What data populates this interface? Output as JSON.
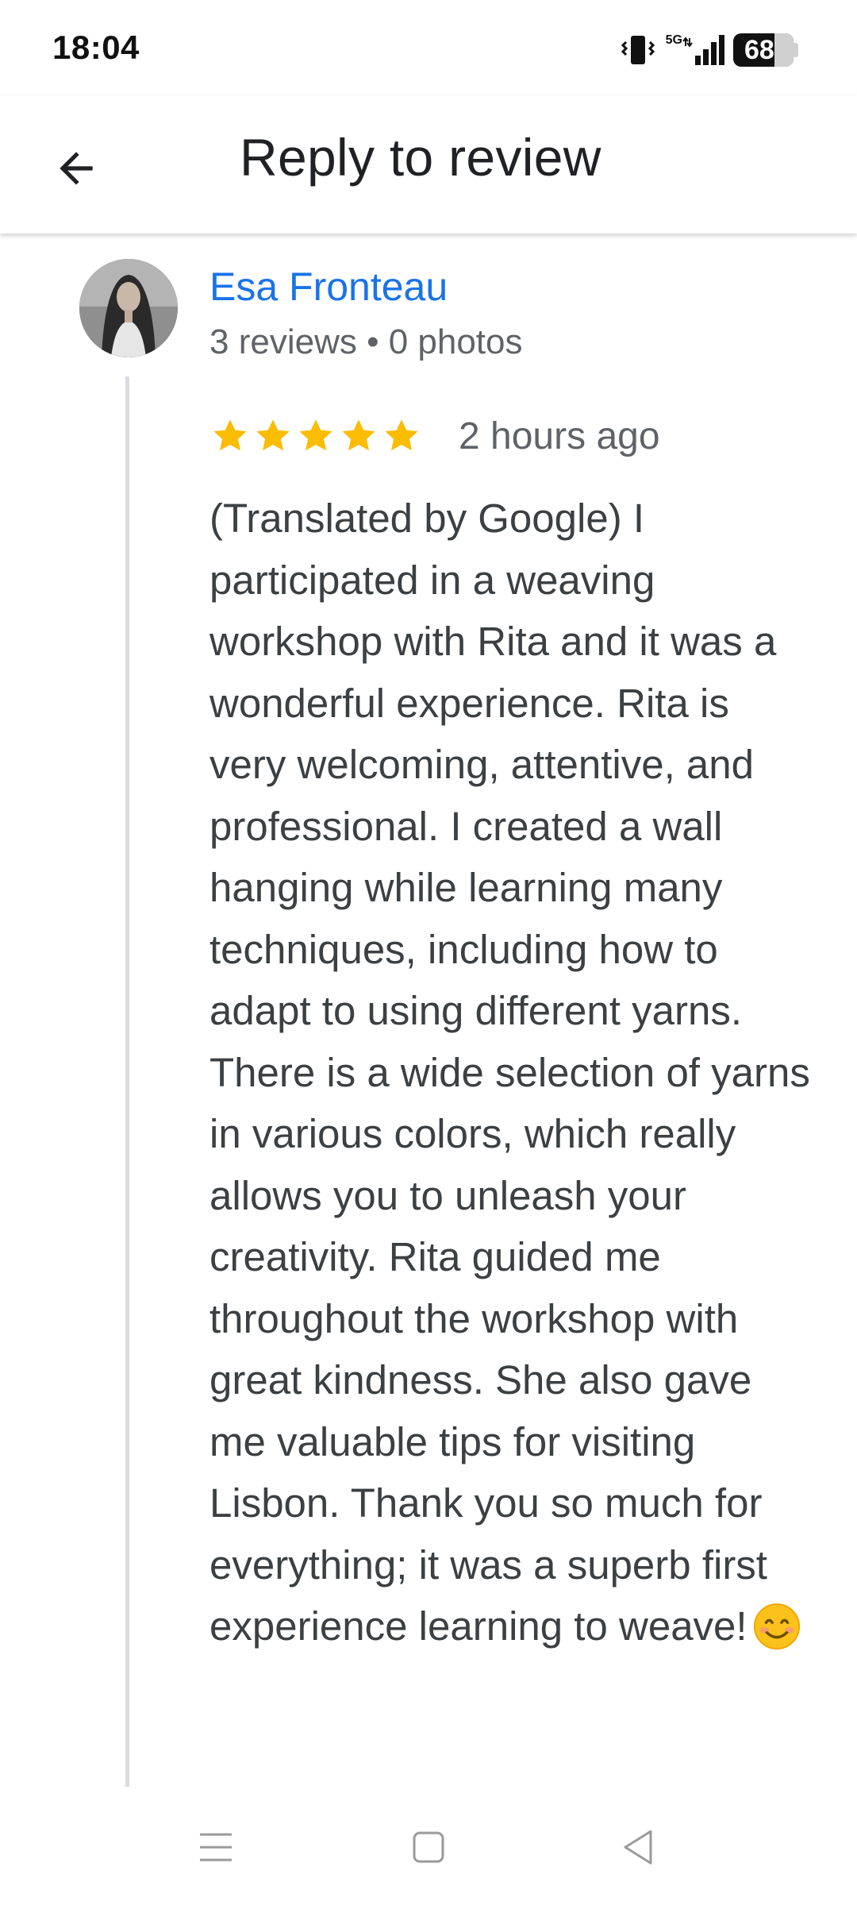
{
  "status_bar": {
    "time": "18:04",
    "network_type": "5G",
    "battery_level": "68",
    "battery_fraction": 0.68
  },
  "app_bar": {
    "title": "Reply to review",
    "back_icon": "arrow-back-icon"
  },
  "review": {
    "reviewer_name": "Esa Fronteau",
    "reviewer_meta": "3 reviews • 0 photos",
    "rating": 5,
    "rating_max": 5,
    "time_ago": "2 hours ago",
    "text": "(Translated by Google) I participated in a weaving workshop with Rita and it was a wonderful experience. Rita is very welcoming, attentive, and professional. I created a wall hanging while learning many techniques, including how to adapt to using different yarns. There is a wide selection of yarns in various colors, which really allows you to unleash your creativity. Rita guided me throughout the workshop with great kindness. She also gave me valuable tips for visiting Lisbon. Thank you so much for everything; it was a superb first experience learning to weave!",
    "trailing_emoji": "smiling-face-icon"
  },
  "nav_bar": {
    "items": [
      "menu-icon",
      "home-square-icon",
      "back-triangle-icon"
    ]
  },
  "colors": {
    "accent": "#1a73e8",
    "star": "#fbbc04",
    "text": "#3c4043",
    "secondary_text": "#5f6368",
    "divider": "#dadce0"
  }
}
